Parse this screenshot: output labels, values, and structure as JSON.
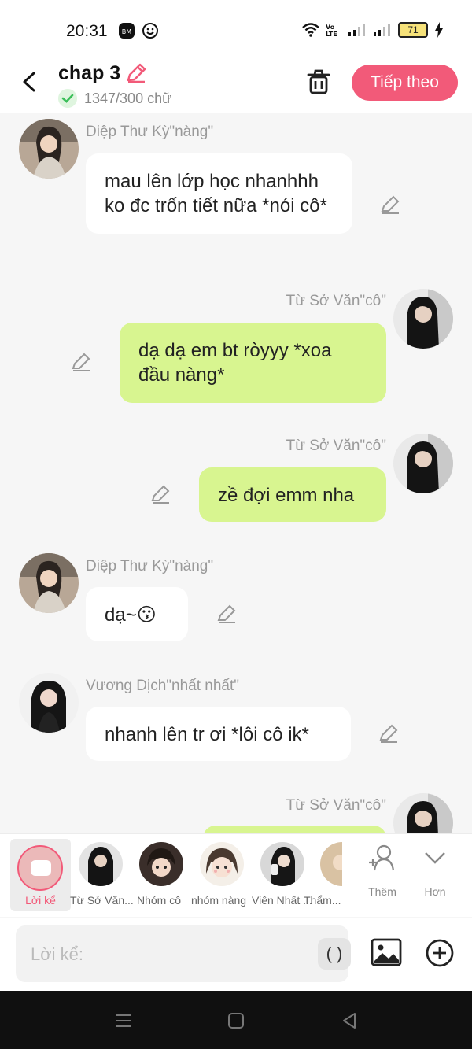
{
  "status": {
    "time": "20:31",
    "battery": "71"
  },
  "header": {
    "title": "chap 3",
    "word_count": "1347/300 chữ",
    "next_label": "Tiếp theo"
  },
  "messages": [
    {
      "sender": "Diệp Thư Kỳ\"nàng\"",
      "text": "mau lên lớp học nhanhhh ko đc trốn tiết nữa *nói cô*",
      "side": "left"
    },
    {
      "sender": "Từ Sở Văn\"cô\"",
      "text": "dạ dạ em bt ròyyy *xoa đầu nàng*",
      "side": "right"
    },
    {
      "sender": "Từ Sở Văn\"cô\"",
      "text": "zề đợi emm nha",
      "side": "right"
    },
    {
      "sender": "Diệp Thư Kỳ\"nàng\"",
      "text": "dạ~😗",
      "side": "left"
    },
    {
      "sender": "Vương Dịch\"nhất nhất\"",
      "text": "nhanh lên tr ơi *lôi cô ik*",
      "side": "left"
    },
    {
      "sender": "Từ Sở Văn\"cô\"",
      "text": "",
      "side": "right"
    }
  ],
  "strip": {
    "narrator_label": "Lời kể",
    "characters": [
      {
        "label": "Từ Sở Văn..."
      },
      {
        "label": "Nhóm cô"
      },
      {
        "label": "nhóm nàng"
      },
      {
        "label": "Viên Nhất ..."
      },
      {
        "label": "Thẩm..."
      }
    ],
    "more_label": "Thêm",
    "expand_label": "Hơn"
  },
  "input": {
    "placeholder": "Lời kể:",
    "paren_label": "( )"
  },
  "colors": {
    "accent": "#f25a79",
    "green_bubble": "#d8f590",
    "white_bubble": "#ffffff"
  },
  "icons": [
    "back-arrow-icon",
    "pencil-icon",
    "check-icon",
    "trash-icon",
    "image-icon",
    "plus-circle-icon",
    "person-add-icon",
    "chevron-down-icon",
    "menu-icon",
    "home-square-icon",
    "back-triangle-icon"
  ]
}
